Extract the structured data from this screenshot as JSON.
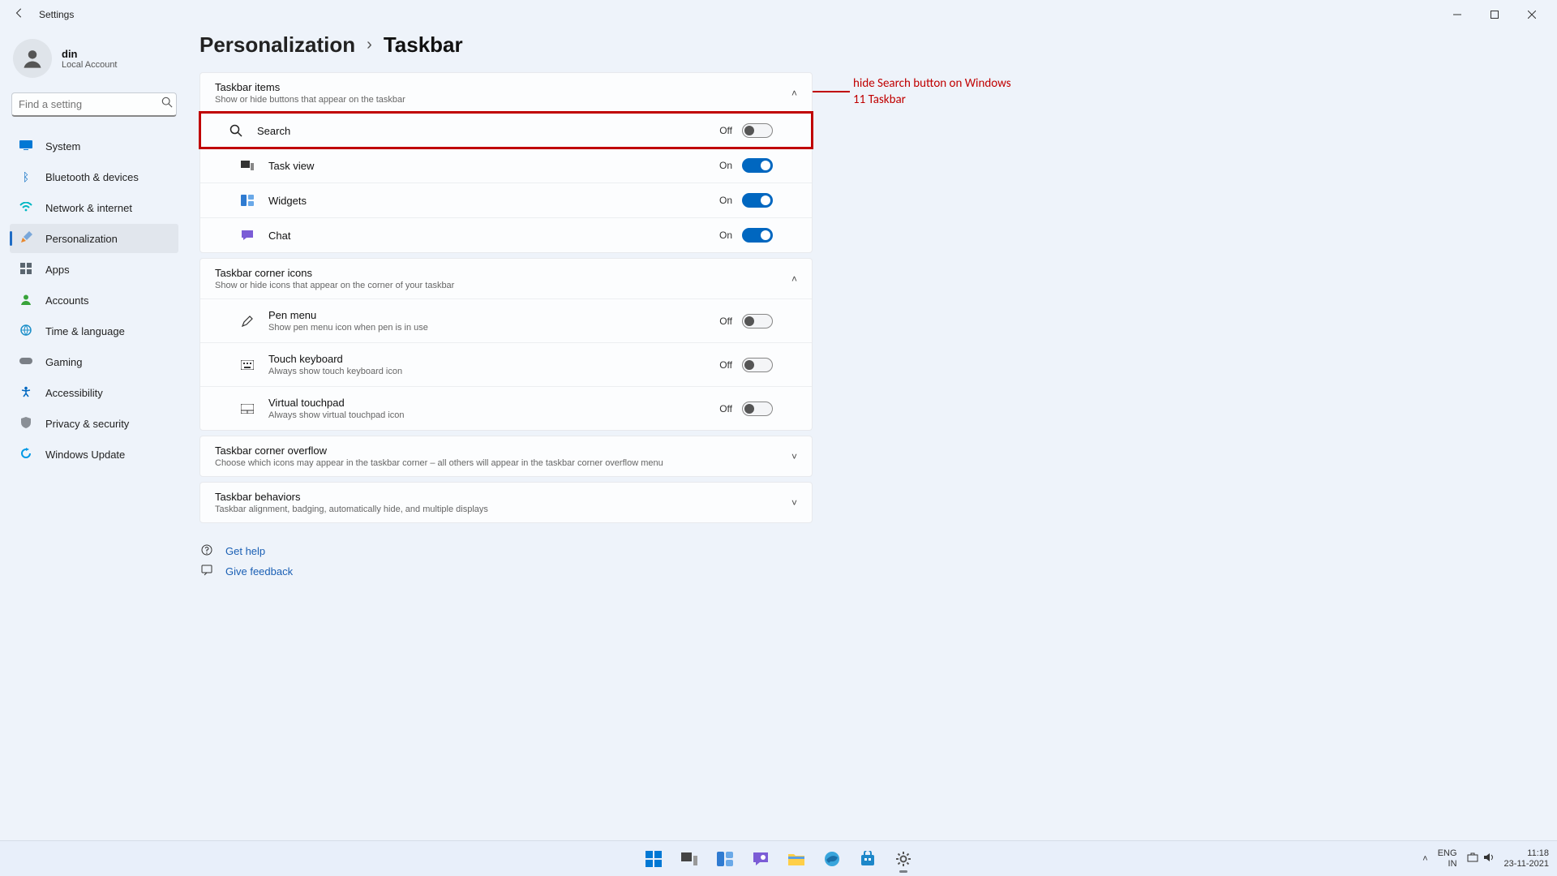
{
  "titlebar": {
    "title": "Settings"
  },
  "user": {
    "name": "din",
    "account_type": "Local Account"
  },
  "search": {
    "placeholder": "Find a setting"
  },
  "nav": [
    {
      "label": "System",
      "icon_color": "#0078d4"
    },
    {
      "label": "Bluetooth & devices",
      "icon_color": "#0067c0"
    },
    {
      "label": "Network & internet",
      "icon_color": "#00b7c3"
    },
    {
      "label": "Personalization",
      "icon_color": "#e8882e"
    },
    {
      "label": "Apps",
      "icon_color": "#5b6670"
    },
    {
      "label": "Accounts",
      "icon_color": "#38a33a"
    },
    {
      "label": "Time & language",
      "icon_color": "#1e90c9"
    },
    {
      "label": "Gaming",
      "icon_color": "#7a7f86"
    },
    {
      "label": "Accessibility",
      "icon_color": "#0067c0"
    },
    {
      "label": "Privacy & security",
      "icon_color": "#8a8f96"
    },
    {
      "label": "Windows Update",
      "icon_color": "#0099e5"
    }
  ],
  "breadcrumb": {
    "parent": "Personalization",
    "current": "Taskbar"
  },
  "sections": {
    "taskbar_items": {
      "title": "Taskbar items",
      "subtitle": "Show or hide buttons that appear on the taskbar",
      "rows": [
        {
          "label": "Search",
          "state": "Off",
          "on": false
        },
        {
          "label": "Task view",
          "state": "On",
          "on": true
        },
        {
          "label": "Widgets",
          "state": "On",
          "on": true
        },
        {
          "label": "Chat",
          "state": "On",
          "on": true
        }
      ]
    },
    "corner_icons": {
      "title": "Taskbar corner icons",
      "subtitle": "Show or hide icons that appear on the corner of your taskbar",
      "rows": [
        {
          "label": "Pen menu",
          "desc": "Show pen menu icon when pen is in use",
          "state": "Off"
        },
        {
          "label": "Touch keyboard",
          "desc": "Always show touch keyboard icon",
          "state": "Off"
        },
        {
          "label": "Virtual touchpad",
          "desc": "Always show virtual touchpad icon",
          "state": "Off"
        }
      ]
    },
    "corner_overflow": {
      "title": "Taskbar corner overflow",
      "subtitle": "Choose which icons may appear in the taskbar corner – all others will appear in the taskbar corner overflow menu"
    },
    "behaviors": {
      "title": "Taskbar behaviors",
      "subtitle": "Taskbar alignment, badging, automatically hide, and multiple displays"
    }
  },
  "callout": "hide Search button on Windows 11 Taskbar",
  "help": {
    "get_help": "Get help",
    "feedback": "Give feedback"
  },
  "tray": {
    "lang1": "ENG",
    "lang2": "IN",
    "time": "11:18",
    "date": "23-11-2021"
  }
}
